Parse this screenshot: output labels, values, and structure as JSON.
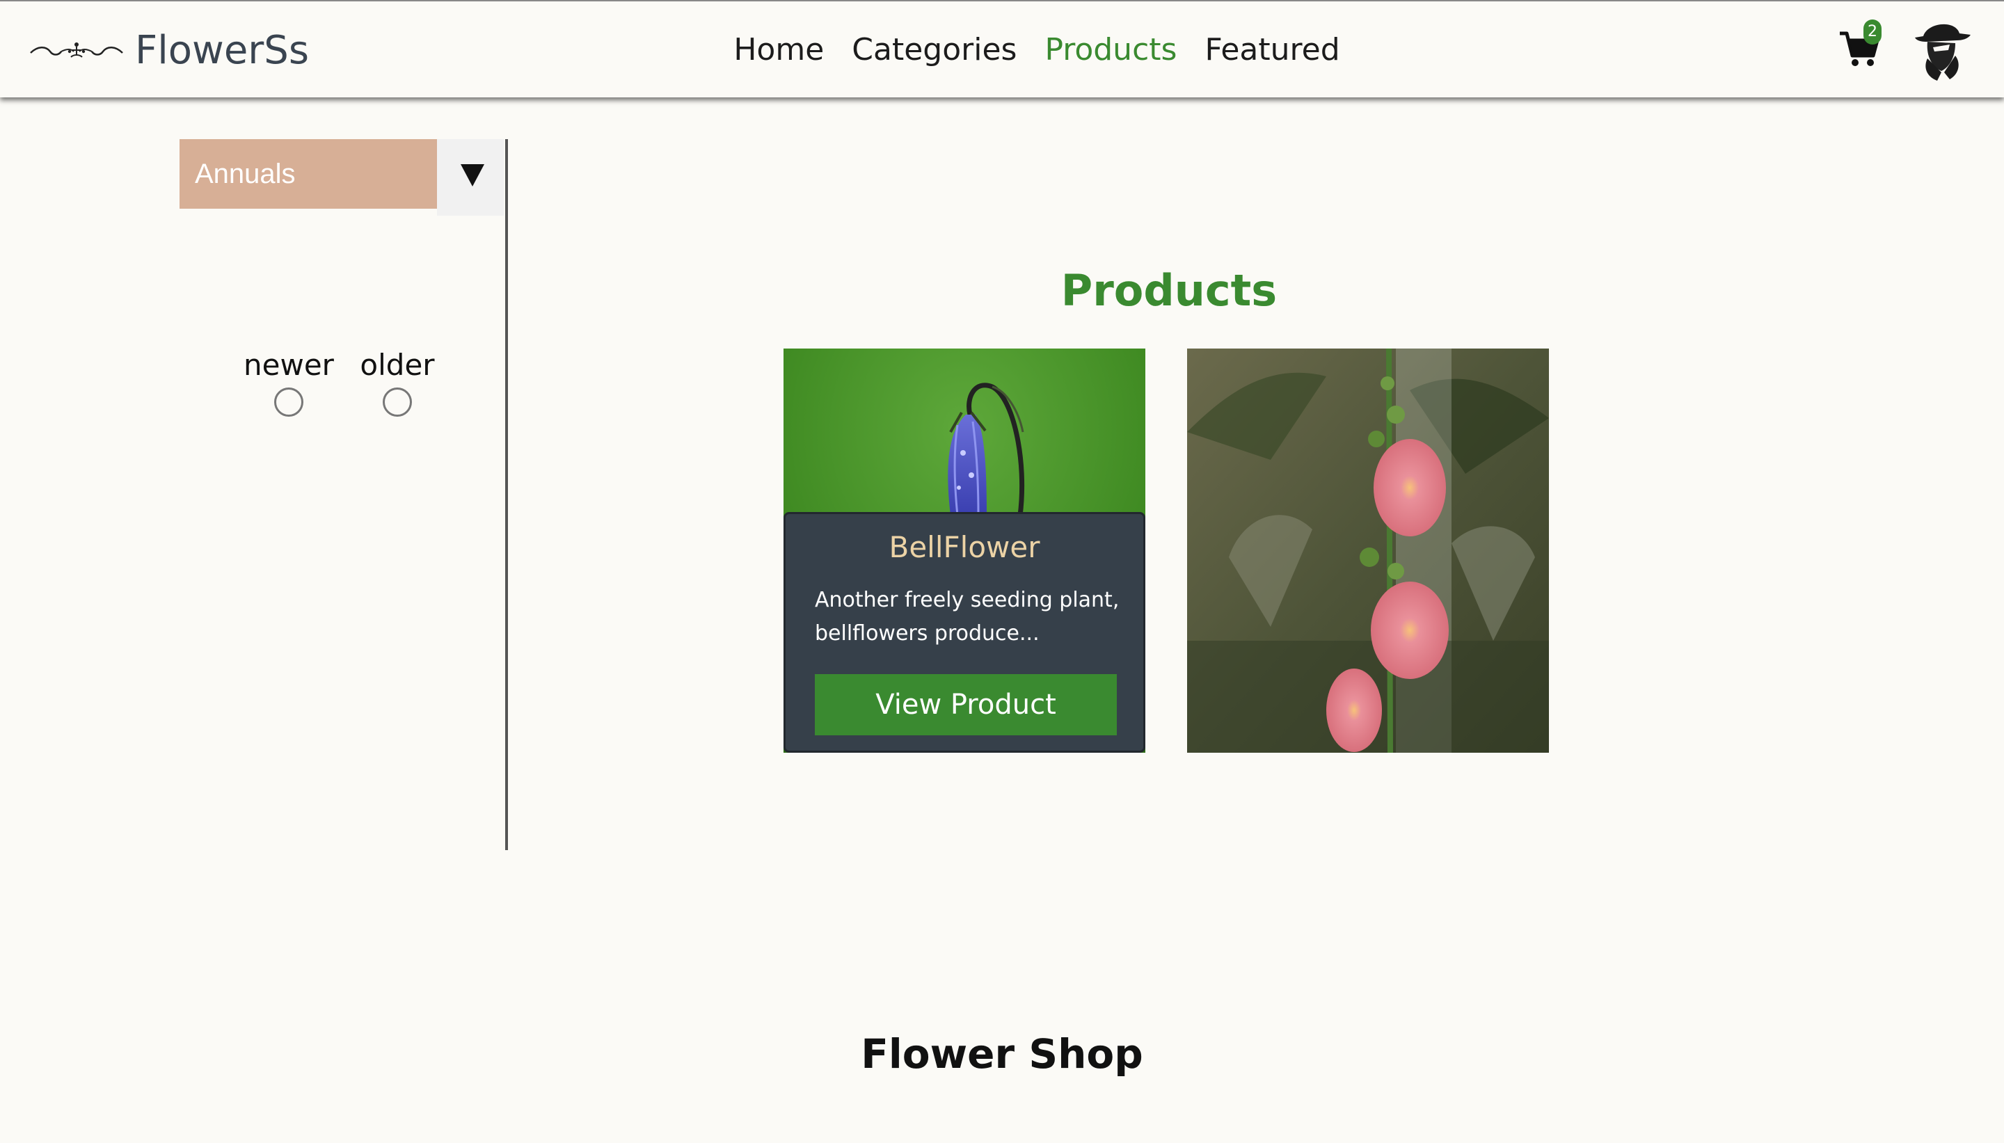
{
  "header": {
    "brand_icon": "flourish-ornament-icon",
    "brand_name": "FlowerSs",
    "nav": [
      {
        "label": "Home",
        "active": false
      },
      {
        "label": "Categories",
        "active": false
      },
      {
        "label": "Products",
        "active": true
      },
      {
        "label": "Featured",
        "active": false
      }
    ],
    "cart_icon": "shopping-cart-icon",
    "cart_count": "2",
    "avatar_icon": "user-avatar-icon"
  },
  "sidebar": {
    "category_select": {
      "selected": "Annuals",
      "arrow_icon": "triangle-down-icon"
    },
    "sort_options": [
      {
        "label": "newer",
        "checked": false
      },
      {
        "label": "older",
        "checked": false
      }
    ]
  },
  "main": {
    "title": "Products",
    "products": [
      {
        "name": "BellFlower",
        "description": "Another freely seeding plant, bellflowers produce...",
        "button_label": "View Product",
        "image": "bellflower-photo"
      },
      {
        "image": "hollyhock-photo"
      }
    ]
  },
  "footer": {
    "title": "Flower Shop"
  },
  "colors": {
    "background": "#fbfaf6",
    "accent_green": "#3a8a30",
    "select_bg": "#d7af96",
    "card_panel": "#36404a",
    "card_title": "#ecd3a6",
    "brand_text": "#3a4450"
  }
}
